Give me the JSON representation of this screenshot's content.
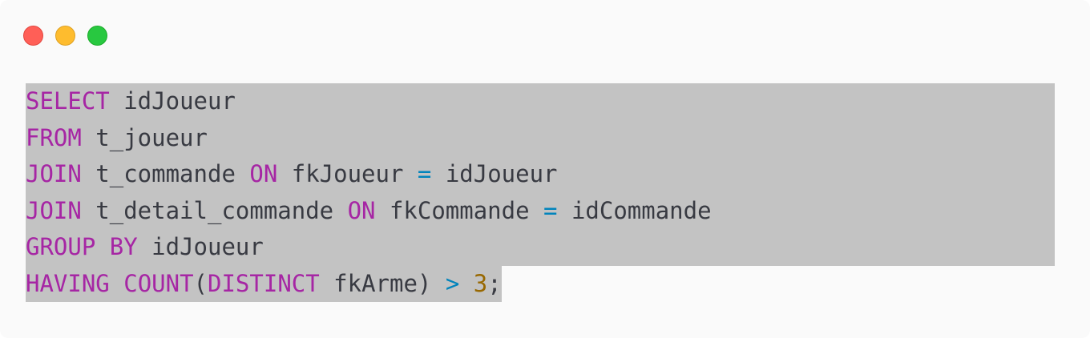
{
  "window": {
    "controls": [
      "close",
      "minimize",
      "maximize"
    ],
    "colors": {
      "close": "#ff5f57",
      "minimize": "#febc2e",
      "maximize": "#28c840",
      "keyword": "#a626a4",
      "operator": "#0184bc",
      "number": "#986801",
      "text": "#383a42",
      "selection": "#c3c3c3"
    }
  },
  "code": {
    "language": "sql",
    "lines": [
      [
        {
          "t": "SELECT",
          "k": "kw"
        },
        {
          "t": " idJoueur",
          "k": "txt"
        }
      ],
      [
        {
          "t": "FROM",
          "k": "kw"
        },
        {
          "t": " t_joueur",
          "k": "txt"
        }
      ],
      [
        {
          "t": "JOIN",
          "k": "kw"
        },
        {
          "t": " t_commande ",
          "k": "txt"
        },
        {
          "t": "ON",
          "k": "kw"
        },
        {
          "t": " fkJoueur ",
          "k": "txt"
        },
        {
          "t": "=",
          "k": "op"
        },
        {
          "t": " idJoueur",
          "k": "txt"
        }
      ],
      [
        {
          "t": "JOIN",
          "k": "kw"
        },
        {
          "t": " t_detail_commande ",
          "k": "txt"
        },
        {
          "t": "ON",
          "k": "kw"
        },
        {
          "t": " fkCommande ",
          "k": "txt"
        },
        {
          "t": "=",
          "k": "op"
        },
        {
          "t": " idCommande",
          "k": "txt"
        }
      ],
      [
        {
          "t": "GROUP",
          "k": "kw"
        },
        {
          "t": " ",
          "k": "txt"
        },
        {
          "t": "BY",
          "k": "kw"
        },
        {
          "t": " idJoueur",
          "k": "txt"
        }
      ],
      [
        {
          "t": "HAVING",
          "k": "kw"
        },
        {
          "t": " ",
          "k": "txt"
        },
        {
          "t": "COUNT",
          "k": "kw"
        },
        {
          "t": "(",
          "k": "txt"
        },
        {
          "t": "DISTINCT",
          "k": "kw"
        },
        {
          "t": " fkArme) ",
          "k": "txt"
        },
        {
          "t": ">",
          "k": "op"
        },
        {
          "t": " ",
          "k": "txt"
        },
        {
          "t": "3",
          "k": "num"
        },
        {
          "t": ";",
          "k": "txt"
        }
      ]
    ]
  }
}
